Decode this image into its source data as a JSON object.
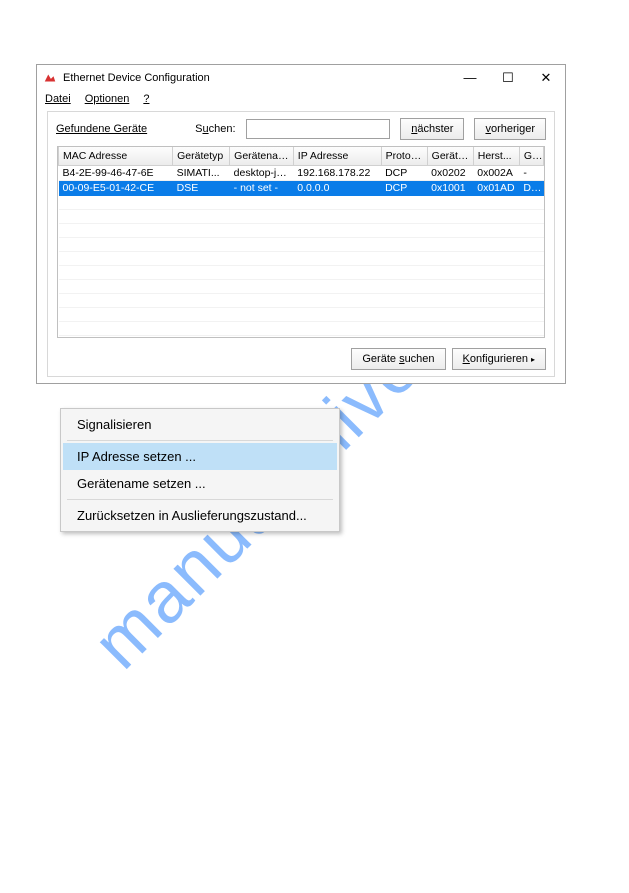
{
  "watermark": "manualshive.com",
  "window": {
    "title": "Ethernet Device Configuration",
    "minimize_glyph": "—",
    "maximize_glyph": "☐",
    "close_glyph": "✕"
  },
  "menubar": {
    "file": "Datei",
    "options": "Optionen",
    "help": "?"
  },
  "toolbar": {
    "found_label": "Gefundene Geräte",
    "search_label": "Suchen:",
    "search_value": "",
    "next_btn": "nächster",
    "prev_btn": "vorheriger",
    "search_devices_btn": "Geräte suchen",
    "configure_btn": "Konfigurieren",
    "configure_arrow": "▸"
  },
  "table": {
    "columns": [
      "MAC Adresse",
      "Gerätetyp",
      "Gerätename",
      "IP Adresse",
      "Protokoll",
      "Gerät ...",
      "Herst...",
      "G..."
    ],
    "widths": [
      104,
      52,
      58,
      80,
      42,
      42,
      42,
      22
    ],
    "rows": [
      {
        "cells": [
          "B4-2E-99-46-47-6E",
          "SIMATI...",
          "desktop-jp...",
          "192.168.178.22",
          "DCP",
          "0x0202",
          "0x002A",
          "-"
        ],
        "selected": false
      },
      {
        "cells": [
          "00-09-E5-01-42-CE",
          "DSE",
          "- not set -",
          "0.0.0.0",
          "DCP",
          "0x1001",
          "0x01AD",
          "D..."
        ],
        "selected": true
      }
    ],
    "empty_rows": 11
  },
  "context_menu": {
    "items": [
      {
        "label": "Signalisieren",
        "highlight": false
      },
      {
        "divider": true
      },
      {
        "label": "IP Adresse setzen ...",
        "highlight": true
      },
      {
        "label": "Gerätename setzen ...",
        "highlight": false
      },
      {
        "divider": true
      },
      {
        "label": "Zurücksetzen in Auslieferungszustand...",
        "highlight": false
      }
    ]
  }
}
